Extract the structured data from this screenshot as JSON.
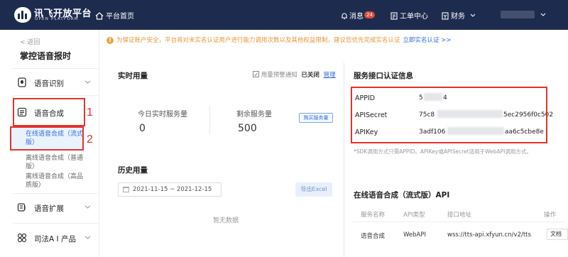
{
  "topbar": {
    "brand_name": "讯飞开放平台",
    "brand_sub": "OPEN PLATFORM",
    "home_label": "平台首页",
    "messages_label": "消息",
    "messages_count": "24",
    "tickets_label": "工单中心",
    "finance_label": "财务",
    "colors": {
      "bg": "#1d2b4f"
    }
  },
  "sidebar": {
    "back_label": "< 返回",
    "app_name": "掌控语音报时",
    "menu": [
      {
        "label": "语音识别",
        "icon": "speech-recognition-icon"
      },
      {
        "label": "语音合成",
        "icon": "speech-synthesis-icon"
      },
      {
        "label": "语音扩展",
        "icon": "speech-extension-icon"
      },
      {
        "label": "司法A I 产品",
        "icon": "judicial-ai-icon"
      }
    ],
    "sub_items": [
      {
        "label": "在线语音合成（流式版）",
        "active": true
      },
      {
        "label": "离线语音合成（普通版）",
        "active": false
      },
      {
        "label": "离线语音合成（高品质版）",
        "active": false
      }
    ],
    "annotations": {
      "first": "1",
      "second": "2"
    }
  },
  "notice": {
    "text": "为保证账户安全，平台将对未实名认证用户进行能力调用次数以及其他权益限制，建议您优先完成实名认证",
    "link": "立即实名认证 >>"
  },
  "usage": {
    "title": "实时用量",
    "alert_label": "用量预警通知",
    "alert_status": "已关闭",
    "manage_label": "管理",
    "today_label": "今日实时服务量",
    "today_value": "0",
    "remaining_label": "剩余服务量",
    "remaining_value": "500",
    "buy_label": "购买服务量"
  },
  "history": {
    "title": "历史用量",
    "date_range": "2021-11-15 ~ 2021-12-15",
    "export_label": "导出Excel",
    "empty_label": "暂无数据"
  },
  "credentials": {
    "title": "服务接口认证信息",
    "appid_label": "APPID",
    "appid_value_start": "5",
    "appid_value_end": "4",
    "secret_label": "APISecret",
    "secret_value_start": "75c8",
    "secret_value_end": "5ec2956f0c502",
    "key_label": "APIKey",
    "key_value_start": "3adf106",
    "key_value_end": "aa6c5cbe8e",
    "hint": "*SDK调用方式只需APPID。APIKey或APISecret适用于WebAPI调用方式。"
  },
  "api": {
    "title": "在线语音合成（流式版）API",
    "columns": [
      "服务名称",
      "API类型",
      "接口地址",
      "操作"
    ],
    "row": {
      "name": "语音合成",
      "type": "WebAPI",
      "url": "wss://tts-api.xfyun.cn/v2/tts",
      "action": "文档"
    }
  },
  "accent_color": "#2f6fe0",
  "annotation_color": "#e4322b"
}
